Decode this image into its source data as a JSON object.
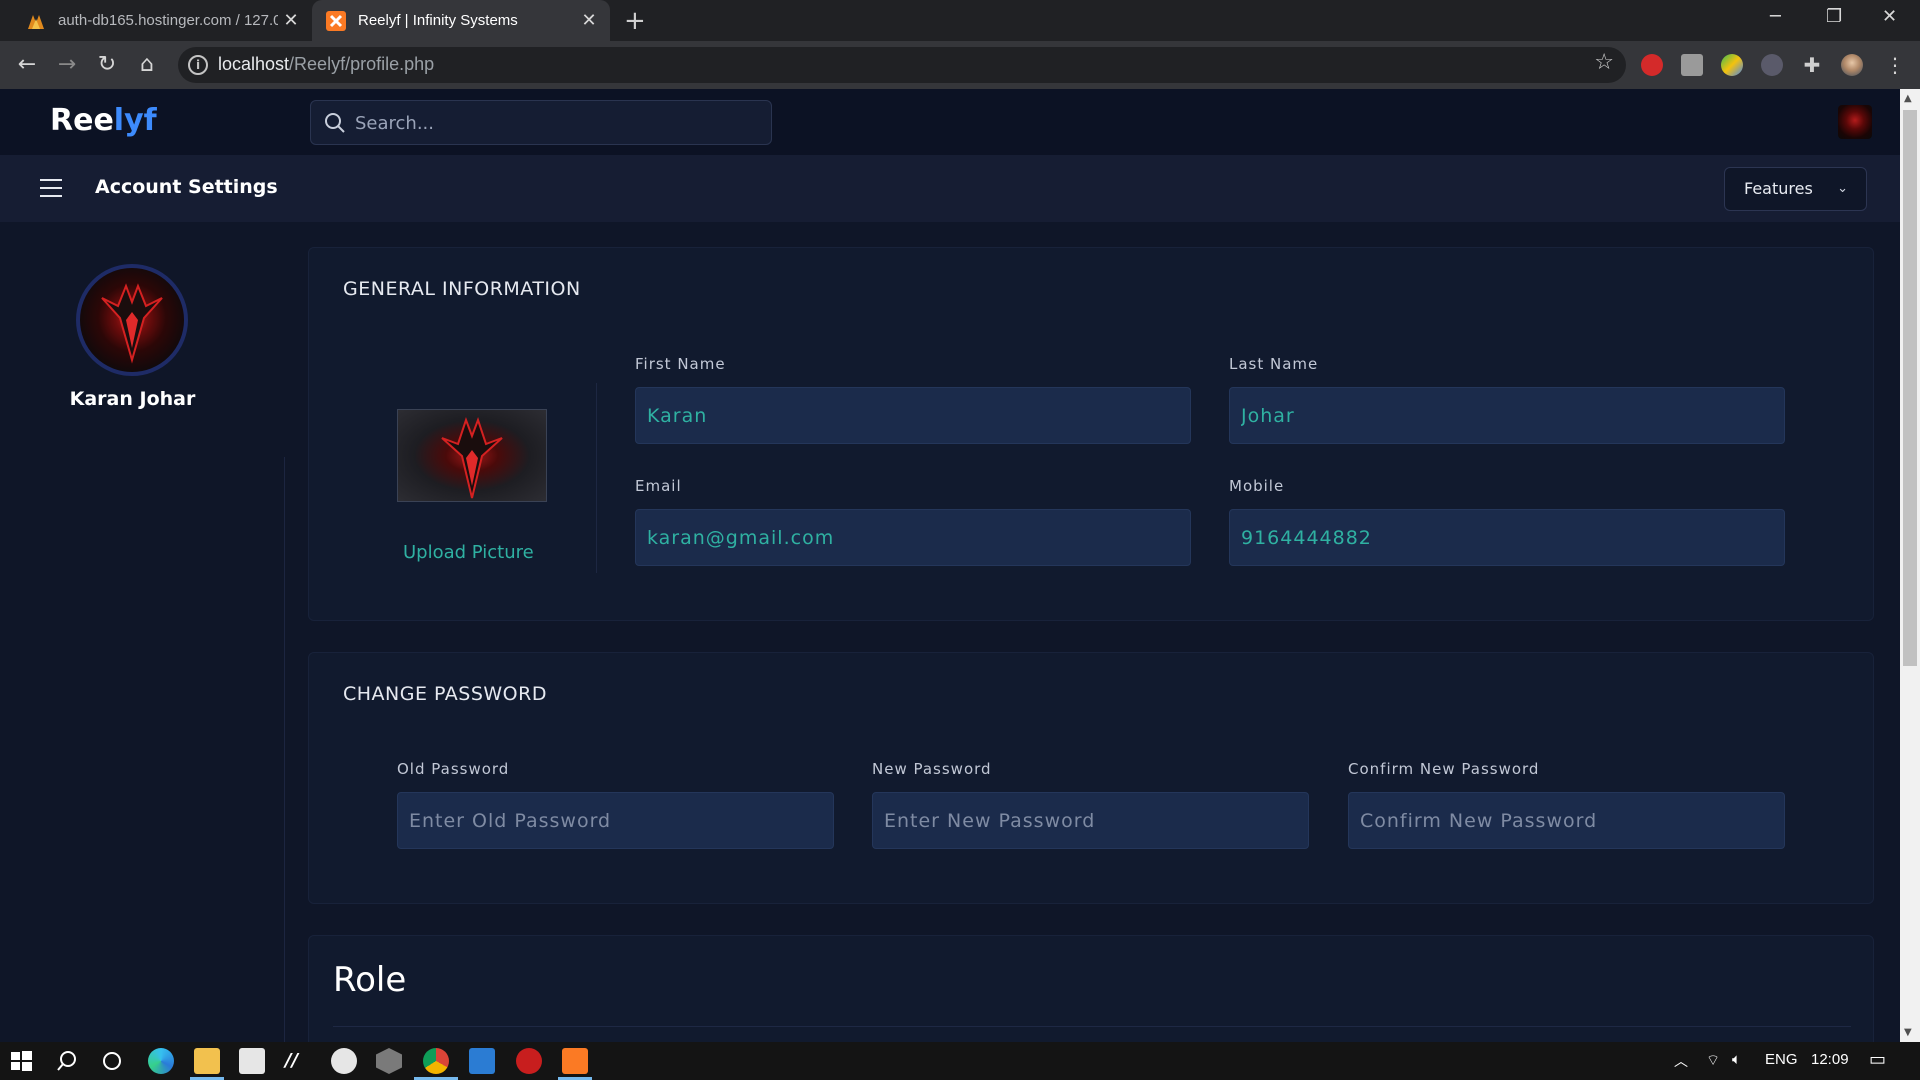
{
  "browser": {
    "tabs": [
      {
        "title": "auth-db165.hostinger.com / 127.0",
        "active": false
      },
      {
        "title": "Reelyf | Infinity Systems",
        "active": true
      }
    ],
    "url_host": "localhost",
    "url_path": "/Reelyf/profile.php"
  },
  "header": {
    "logo_primary": "Ree",
    "logo_accent": "lyf",
    "search_placeholder": "Search..."
  },
  "subheader": {
    "title": "Account Settings",
    "features_label": "Features"
  },
  "sidebar": {
    "user_name": "Karan Johar"
  },
  "general": {
    "heading": "GENERAL INFORMATION",
    "upload_label": "Upload Picture",
    "first_name_label": "First Name",
    "first_name": "Karan",
    "last_name_label": "Last Name",
    "last_name": "Johar",
    "email_label": "Email",
    "email": "karan@gmail.com",
    "mobile_label": "Mobile",
    "mobile": "9164444882"
  },
  "password": {
    "heading": "CHANGE PASSWORD",
    "old_label": "Old Password",
    "old_placeholder": "Enter Old Password",
    "new_label": "New Password",
    "new_placeholder": "Enter New Password",
    "confirm_label": "Confirm New Password",
    "confirm_placeholder": "Confirm New Password"
  },
  "role": {
    "heading": "Role"
  },
  "taskbar": {
    "language": "ENG",
    "time": "12:09"
  },
  "colors": {
    "accent_teal": "#2fb1a2",
    "logo_blue": "#3d8bfd",
    "page_bg": "#0f1628",
    "panel_bg": "#111a2e",
    "input_bg": "#1b2b4b"
  }
}
